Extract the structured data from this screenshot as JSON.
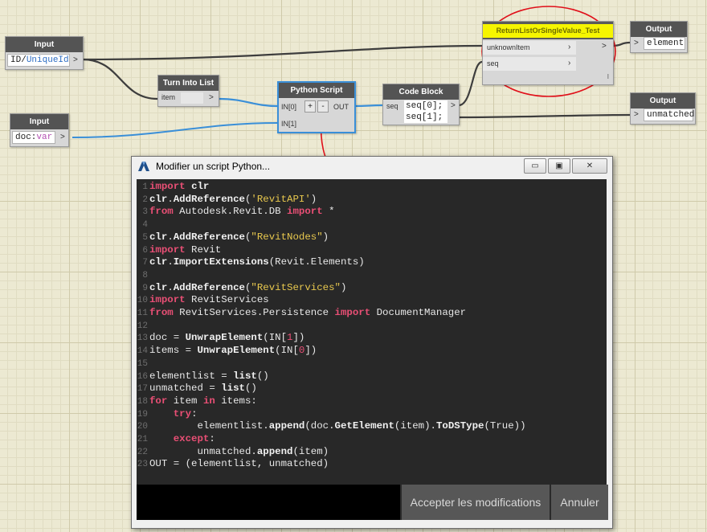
{
  "nodes": {
    "input_id": {
      "title": "Input",
      "value_plain": "ID/",
      "value_colored": "UniqueId",
      "out": ">"
    },
    "input_doc": {
      "title": "Input",
      "value_plain": "doc:",
      "value_colored": "var",
      "out": ">"
    },
    "turn_into_list": {
      "title": "Turn Into List",
      "port_in": "item",
      "out": ">"
    },
    "python_script": {
      "title": "Python Script",
      "port_in0": "IN[0]",
      "port_in1": "IN[1]",
      "plus": "+",
      "minus": "-",
      "port_out": "OUT"
    },
    "code_block": {
      "title": "Code Block",
      "port_in": "seq",
      "line1": "seq[0];",
      "line2": "seq[1];",
      "out": ">"
    },
    "return_list": {
      "title": "ReturnListOrSingleValue_Test",
      "port_in1": "unknownItem",
      "port_in2": "seq",
      "out": ">",
      "corner": "l"
    },
    "output_element": {
      "title": "Output",
      "value": "element"
    },
    "output_unmatched": {
      "title": "Output",
      "value": "unmatched"
    }
  },
  "dialog": {
    "title": "Modifier un script Python...",
    "minimize": "▭",
    "maximize": "▣",
    "close": "✕",
    "accept_label": "Accepter les modifications",
    "cancel_label": "Annuler",
    "code_lines": [
      "import clr",
      "clr.AddReference('RevitAPI')",
      "from Autodesk.Revit.DB import *",
      "",
      "clr.AddReference(\"RevitNodes\")",
      "import Revit",
      "clr.ImportExtensions(Revit.Elements)",
      "",
      "clr.AddReference(\"RevitServices\")",
      "import RevitServices",
      "from RevitServices.Persistence import DocumentManager",
      "",
      "doc = UnwrapElement(IN[1])",
      "items = UnwrapElement(IN[0])",
      "",
      "elementlist = list()",
      "unmatched = list()",
      "for item in items:",
      "    try:",
      "        elementlist.append(doc.GetElement(item).ToDSType(True))",
      "    except:",
      "        unmatched.append(item)",
      "OUT = (elementlist, unmatched)"
    ]
  },
  "colors": {
    "annotation_red": "#e0101a",
    "wire_blue": "#3a8fd8",
    "wire_dark": "#3d3d3d",
    "highlight_yellow": "#f6f500"
  }
}
